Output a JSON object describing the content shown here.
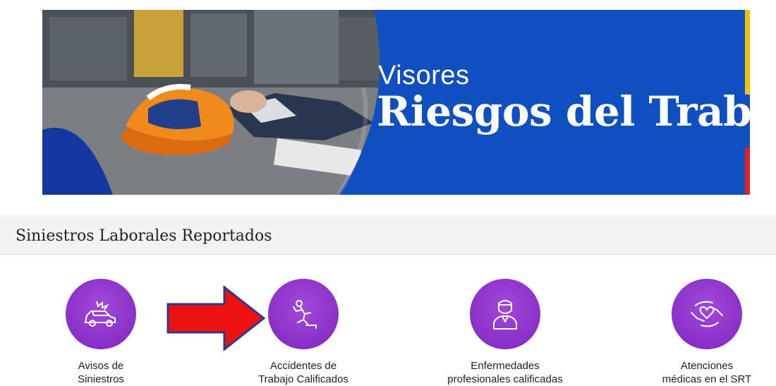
{
  "banner": {
    "subtitle": "Visores",
    "title": "Riesgos del Trabajo"
  },
  "section": {
    "title": "Siniestros Laborales Reportados"
  },
  "items": [
    {
      "line1": "Avisos de",
      "line2": "Siniestros",
      "icon": "car-crash-icon"
    },
    {
      "line1": "Accidentes de",
      "line2": "Trabajo Calificados",
      "icon": "falling-person-icon"
    },
    {
      "line1": "Enfermedades",
      "line2": "profesionales calificadas",
      "icon": "patient-icon"
    },
    {
      "line1": "Atenciones",
      "line2": "médicas en el SRT",
      "icon": "care-hands-heart-icon"
    }
  ],
  "colors": {
    "banner_blue": "#0f4fc0",
    "circle_purple": "#8a2fc8",
    "arrow_red": "#ee1111",
    "arrow_border": "#2b3a8c"
  }
}
